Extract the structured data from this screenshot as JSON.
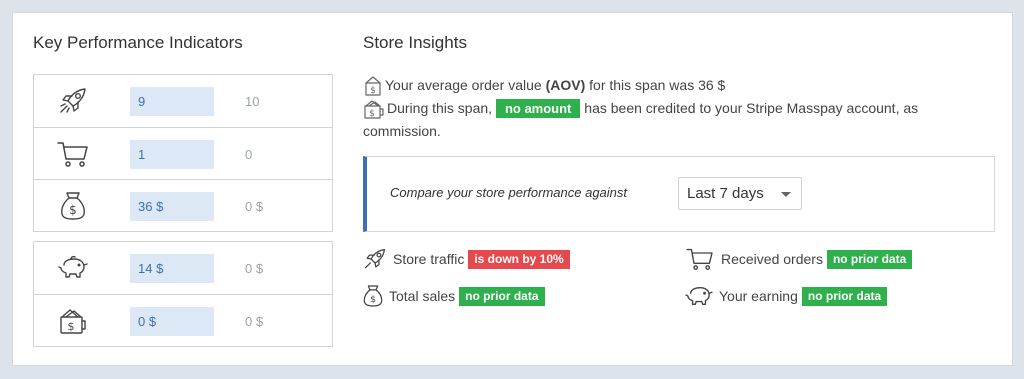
{
  "kpi": {
    "title": "Key Performance Indicators",
    "rows": [
      {
        "icon": "rocket-icon",
        "value": "9",
        "previous": "10"
      },
      {
        "icon": "cart-icon",
        "value": "1",
        "previous": "0"
      },
      {
        "icon": "money-bag-icon",
        "value": "36 $",
        "previous": "0 $"
      },
      {
        "icon": "piggy-bank-icon",
        "value": "14 $",
        "previous": "0 $"
      },
      {
        "icon": "wallet-icon",
        "value": "0 $",
        "previous": "0 $"
      }
    ]
  },
  "insights": {
    "title": "Store Insights",
    "aov_prefix": "Your average order value",
    "aov_bold": "(AOV)",
    "aov_suffix": "for this span was 36 $",
    "credit_prefix": "During this span,",
    "credit_badge": "no amount",
    "credit_suffix": "has been credited to your Stripe Masspay account, as",
    "credit_suffix2": "commission.",
    "compare_label": "Compare your store performance against",
    "compare_selected": "Last 7 days",
    "stats": {
      "traffic_label": "Store traffic",
      "traffic_badge": "is down by 10%",
      "orders_label": "Received orders",
      "orders_badge": "no prior data",
      "sales_label": "Total sales",
      "sales_badge": "no prior data",
      "earning_label": "Your earning",
      "earning_badge": "no prior data"
    }
  },
  "colors": {
    "accent": "#3d70b2",
    "green": "#2eb04c",
    "red": "#e5484d",
    "value_bg": "#dce8f5"
  }
}
